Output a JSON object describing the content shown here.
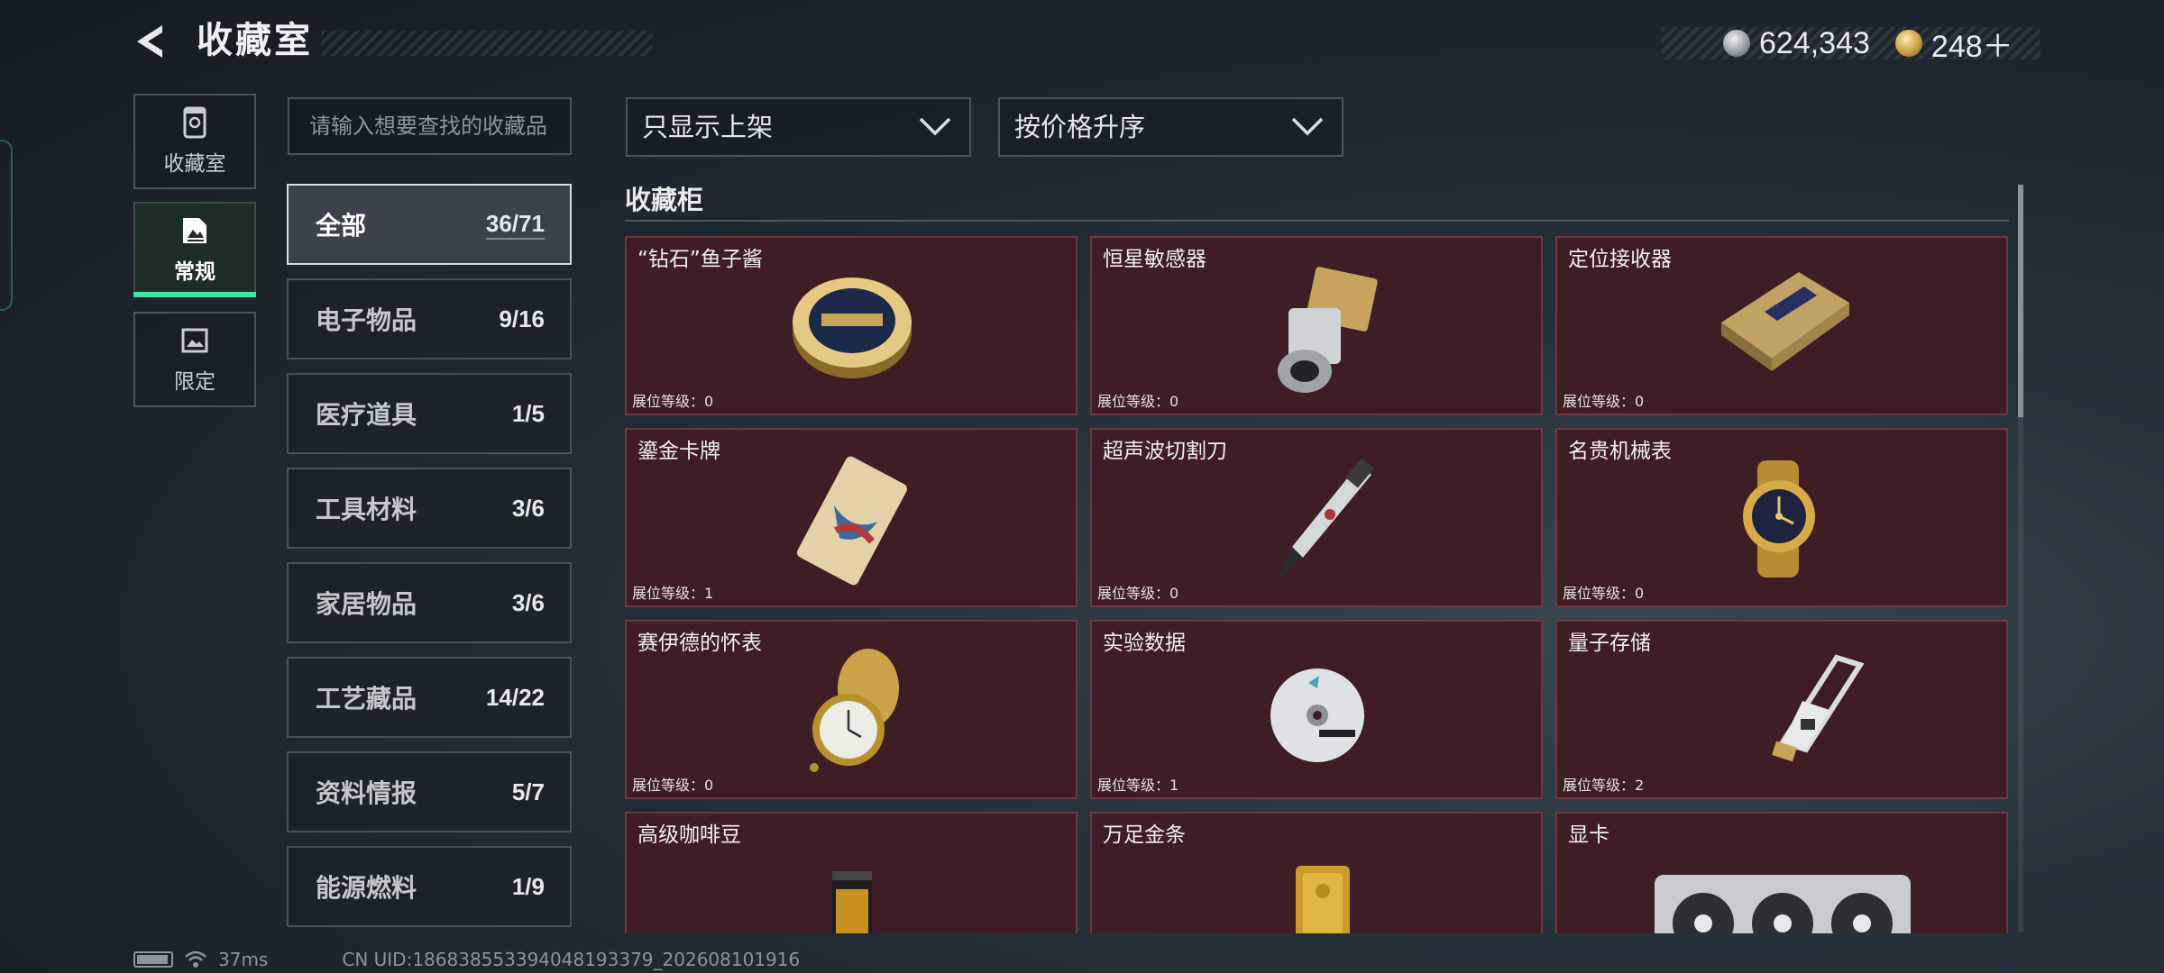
{
  "header": {
    "title": "收藏室",
    "silver_currency": "624,343",
    "gold_currency": "248＋"
  },
  "nav": [
    {
      "label": "收藏室",
      "icon": "vault-icon"
    },
    {
      "label": "常规",
      "icon": "card-icon",
      "active": true
    },
    {
      "label": "限定",
      "icon": "frame-icon"
    }
  ],
  "search": {
    "placeholder": "请输入想要查找的收藏品"
  },
  "categories": [
    {
      "name": "全部",
      "count": "36/71",
      "active": true
    },
    {
      "name": "电子物品",
      "count": "9/16"
    },
    {
      "name": "医疗道具",
      "count": "1/5"
    },
    {
      "name": "工具材料",
      "count": "3/6"
    },
    {
      "name": "家居物品",
      "count": "3/6"
    },
    {
      "name": "工艺藏品",
      "count": "14/22"
    },
    {
      "name": "资料情报",
      "count": "5/7"
    },
    {
      "name": "能源燃料",
      "count": "1/9"
    }
  ],
  "filters": {
    "shelf_filter": "只显示上架",
    "sort": "按价格升序"
  },
  "section": {
    "title": "收藏柜"
  },
  "items": [
    {
      "name": "“钻石”鱼子酱",
      "level": "展位等级：0",
      "icon": "caviar-tin-icon"
    },
    {
      "name": "恒星敏感器",
      "level": "展位等级：0",
      "icon": "star-sensor-icon"
    },
    {
      "name": "定位接收器",
      "level": "展位等级：0",
      "icon": "gps-receiver-icon"
    },
    {
      "name": "鎏金卡牌",
      "level": "展位等级：1",
      "icon": "gilded-card-icon"
    },
    {
      "name": "超声波切割刀",
      "level": "展位等级：0",
      "icon": "ultrasonic-cutter-icon"
    },
    {
      "name": "名贵机械表",
      "level": "展位等级：0",
      "icon": "luxury-watch-icon"
    },
    {
      "name": "赛伊德的怀表",
      "level": "展位等级：0",
      "icon": "pocket-watch-icon"
    },
    {
      "name": "实验数据",
      "level": "展位等级：1",
      "icon": "data-disc-icon"
    },
    {
      "name": "量子存储",
      "level": "展位等级：2",
      "icon": "quantum-storage-icon"
    },
    {
      "name": "高级咖啡豆",
      "level": "",
      "icon": "coffee-bag-icon"
    },
    {
      "name": "万足金条",
      "level": "",
      "icon": "gold-bar-icon"
    },
    {
      "name": "显卡",
      "level": "",
      "icon": "graphics-card-icon"
    }
  ],
  "footer": {
    "ping": "37ms",
    "uid": "CN UID:186838553394048193379_202608101916"
  }
}
